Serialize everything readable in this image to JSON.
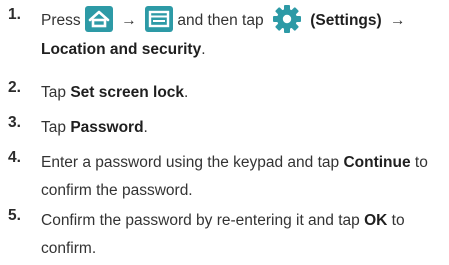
{
  "steps": [
    {
      "number": "1.",
      "press": "Press",
      "arrow": "→",
      "then_tap": "and then tap",
      "settings_paren": "(Settings)",
      "location_security": "Location and security",
      "period": ".",
      "icons": [
        "home-key-icon",
        "menu-key-icon",
        "settings-gear-icon"
      ]
    },
    {
      "number": "2.",
      "tap": "Tap",
      "bold": "Set screen lock",
      "period": "."
    },
    {
      "number": "3.",
      "tap": "Tap",
      "bold": "Password",
      "period": "."
    },
    {
      "number": "4.",
      "line1_pre": "Enter a password using the keypad and tap",
      "bold": "Continue",
      "line1_post": "to",
      "line2": "confirm the password."
    },
    {
      "number": "5.",
      "line1_pre": "Confirm the password by re-entering it and tap",
      "bold": "OK",
      "line1_post": "to",
      "line2": "confirm."
    }
  ],
  "colors": {
    "key_bg": "#2d9aa6",
    "gear": "#2d9aa6",
    "text": "#333333"
  }
}
